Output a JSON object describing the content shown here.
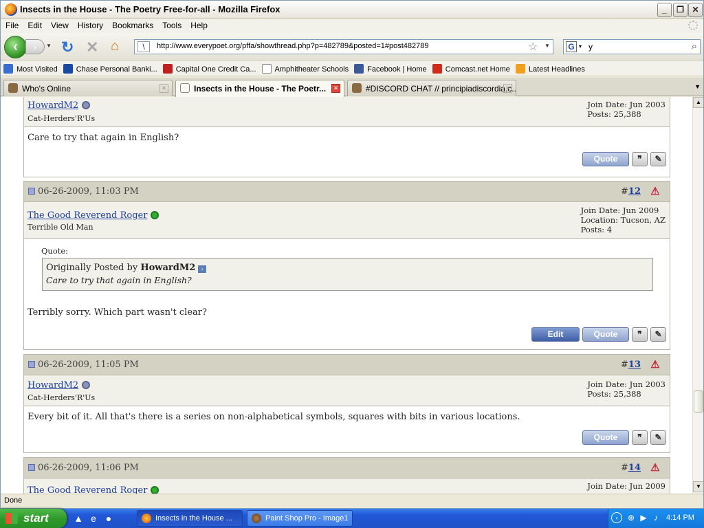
{
  "window": {
    "title": "Insects in the House - The Poetry Free-for-all - Mozilla Firefox",
    "min_label": "_",
    "max_label": "❐",
    "close_label": "✕"
  },
  "menu": [
    "File",
    "Edit",
    "View",
    "History",
    "Bookmarks",
    "Tools",
    "Help"
  ],
  "nav": {
    "url": "http://www.everypoet.org/pffa/showthread.php?p=482789&posted=1#post482789",
    "search_value": "y",
    "search_engine_icon": "G"
  },
  "bookmarks": [
    {
      "label": "Most Visited",
      "color": "#3a6fcf"
    },
    {
      "label": "Chase Personal Banki...",
      "color": "#1a4aa0"
    },
    {
      "label": "Capital One Credit Ca...",
      "color": "#c02020"
    },
    {
      "label": "Amphitheater Schools",
      "color": "#ffffff"
    },
    {
      "label": "Facebook | Home",
      "color": "#3b5998"
    },
    {
      "label": "Comcast.net Home",
      "color": "#d02a1a"
    },
    {
      "label": "Latest Headlines",
      "color": "#f0a020"
    }
  ],
  "tabs": [
    {
      "label": "Who's Online"
    },
    {
      "label": "Insects in the House - The Poetr..."
    },
    {
      "label": "#DISCORD CHAT // principiadiscordia.c..."
    }
  ],
  "posts": [
    {
      "user": "HowardM2",
      "user_title": "Cat-Herders'R'Us",
      "status_color": "#8a93b8",
      "meta": [
        "Join Date: Jun 2003",
        "Posts: 25,388"
      ],
      "body": "Care to try that again in English?"
    },
    {
      "date": "06-26-2009, 11:03 PM",
      "num_prefix": "#",
      "num": "12",
      "user": "The Good Reverend Roger",
      "user_title": "Terrible Old Man",
      "status_color": "#2eb02e",
      "meta": [
        "Join Date: Jun 2009",
        "Location: Tucson, AZ",
        "Posts: 4"
      ],
      "quote_label": "Quote:",
      "quote_by_prefix": "Originally Posted by",
      "quote_by": "HowardM2",
      "quote_text": "Care to try that again in English?",
      "body": "Terribly sorry. Which part wasn't clear?"
    },
    {
      "date": "06-26-2009, 11:05 PM",
      "num_prefix": "#",
      "num": "13",
      "user": "HowardM2",
      "user_title": "Cat-Herders'R'Us",
      "status_color": "#8a93b8",
      "meta": [
        "Join Date: Jun 2003",
        "Posts: 25,388"
      ],
      "body": "Every bit of it. All that's there is a series on non-alphabetical symbols, squares with bits in various locations."
    },
    {
      "date": "06-26-2009, 11:06 PM",
      "num_prefix": "#",
      "num": "14",
      "user": "The Good Reverend Roger",
      "status_color": "#2eb02e",
      "meta": [
        "Join Date: Jun 2009"
      ]
    }
  ],
  "buttons": {
    "quote": "Quote",
    "edit": "Edit"
  },
  "status": "Done",
  "taskbar": {
    "start": "start",
    "tasks": [
      {
        "label": "Insects in the House ..."
      },
      {
        "label": "Paint Shop Pro - Image1"
      }
    ],
    "clock": "4:14 PM"
  }
}
